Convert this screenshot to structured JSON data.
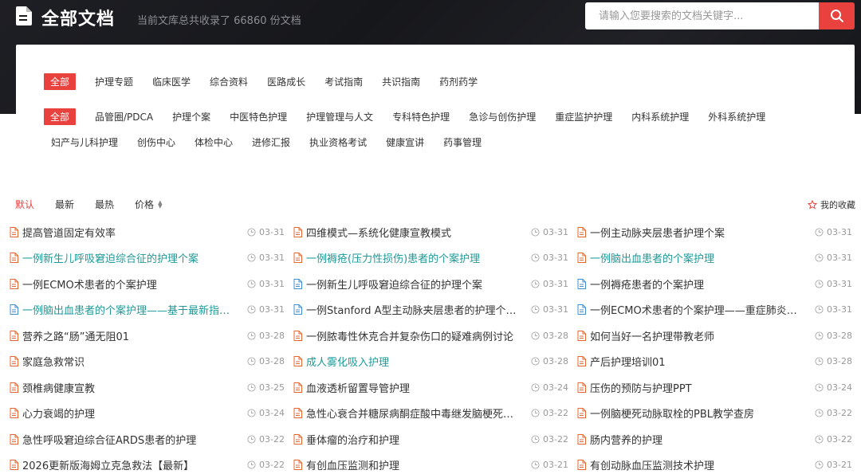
{
  "header": {
    "title": "全部文档",
    "subtitle": "当前文库总共收录了 66860 份文档",
    "search_placeholder": "请输入您要搜索的文档关键字..."
  },
  "filters": {
    "row1": [
      "全部",
      "护理专题",
      "临床医学",
      "综合资料",
      "医路成长",
      "考试指南",
      "共识指南",
      "药剂药学"
    ],
    "row2": [
      "全部",
      "品管圈/PDCA",
      "护理个案",
      "中医特色护理",
      "护理管理与人文",
      "专科特色护理",
      "急诊与创伤护理",
      "重症监护护理",
      "内科系统护理",
      "外科系统护理"
    ],
    "row3": [
      "妇产与儿科护理",
      "创伤中心",
      "体检中心",
      "进修汇报",
      "执业资格考试",
      "健康宣讲",
      "药事管理"
    ]
  },
  "sort": {
    "default": "默认",
    "latest": "最新",
    "hottest": "最热",
    "price": "价格",
    "favorites": "我的收藏"
  },
  "colors": {
    "accent": "#e8413e",
    "teal": "#1d9a98",
    "pdf_icon": "#e8652e",
    "word_icon": "#3d8fd4"
  },
  "documents": [
    [
      {
        "title": "提高管道固定有效率",
        "date": "03-31",
        "icon": "pdf-icon",
        "teal": false
      },
      {
        "title": "一例新生儿呼吸窘迫综合征的护理个案",
        "date": "03-31",
        "icon": "pdf-icon",
        "teal": true
      },
      {
        "title": "一例ECMO术患者的个案护理",
        "date": "03-31",
        "icon": "pdf-icon",
        "teal": false
      },
      {
        "title": "一例脑出血患者的个案护理——基于最新指南...",
        "date": "03-31",
        "icon": "word-icon",
        "teal": true
      },
      {
        "title": "营养之路“肠”通无阻01",
        "date": "03-28",
        "icon": "pdf-icon",
        "teal": false
      },
      {
        "title": "家庭急救常识",
        "date": "03-28",
        "icon": "pdf-icon",
        "teal": false
      },
      {
        "title": "颈椎病健康宣教",
        "date": "03-25",
        "icon": "pdf-icon",
        "teal": false
      },
      {
        "title": "心力衰竭的护理",
        "date": "03-24",
        "icon": "pdf-icon",
        "teal": false
      },
      {
        "title": "急性呼吸窘迫综合征ARDS患者的护理",
        "date": "03-22",
        "icon": "pdf-icon",
        "teal": false
      },
      {
        "title": "2026更新版海姆立克急救法【最新】",
        "date": "03-22",
        "icon": "pdf-icon",
        "teal": false
      }
    ],
    [
      {
        "title": "四维模式—系统化健康宣教模式",
        "date": "03-31",
        "icon": "pdf-icon",
        "teal": false
      },
      {
        "title": "一例褥疮(压力性损伤)患者的个案护理",
        "date": "03-31",
        "icon": "pdf-icon",
        "teal": true
      },
      {
        "title": "一例新生儿呼吸窘迫综合征的护理个案",
        "date": "03-31",
        "icon": "word-icon",
        "teal": false
      },
      {
        "title": "一例Stanford A型主动脉夹层患者的护理个案...",
        "date": "03-31",
        "icon": "word-icon",
        "teal": false
      },
      {
        "title": "一例脓毒性休克合并复杂伤口的疑难病例讨论",
        "date": "03-28",
        "icon": "pdf-icon",
        "teal": false
      },
      {
        "title": "成人雾化吸入护理",
        "date": "03-28",
        "icon": "pdf-icon",
        "teal": true
      },
      {
        "title": "血液透析留置导管护理",
        "date": "03-24",
        "icon": "pdf-icon",
        "teal": false
      },
      {
        "title": "急性心衰合并糖尿病酮症酸中毒继发脑梗死患...",
        "date": "03-22",
        "icon": "pdf-icon",
        "teal": false
      },
      {
        "title": "垂体瘤的治疗和护理",
        "date": "03-22",
        "icon": "pdf-icon",
        "teal": false
      },
      {
        "title": "有创血压监测和护理",
        "date": "03-21",
        "icon": "pdf-icon",
        "teal": false
      }
    ],
    [
      {
        "title": "一例主动脉夹层患者护理个案",
        "date": "03-31",
        "icon": "pdf-icon",
        "teal": false
      },
      {
        "title": "一例脑出血患者的个案护理",
        "date": "03-31",
        "icon": "pdf-icon",
        "teal": true
      },
      {
        "title": "一例褥疮患者的个案护理",
        "date": "03-31",
        "icon": "word-icon",
        "teal": false
      },
      {
        "title": "一例ECMO术患者的个案护理——重症肺炎合...",
        "date": "03-31",
        "icon": "word-icon",
        "teal": false
      },
      {
        "title": "如何当好一名护理带教老师",
        "date": "03-28",
        "icon": "pdf-icon",
        "teal": false
      },
      {
        "title": "产后护理培训01",
        "date": "03-28",
        "icon": "pdf-icon",
        "teal": false
      },
      {
        "title": "压伤的预防与护理PPT",
        "date": "03-24",
        "icon": "pdf-icon",
        "teal": false
      },
      {
        "title": "一例脑梗死动脉取栓的PBL教学查房",
        "date": "03-22",
        "icon": "pdf-icon",
        "teal": false
      },
      {
        "title": "肠内营养的护理",
        "date": "03-22",
        "icon": "pdf-icon",
        "teal": false
      },
      {
        "title": "有创动脉血压监测技术护理",
        "date": "03-21",
        "icon": "pdf-icon",
        "teal": false
      }
    ]
  ]
}
